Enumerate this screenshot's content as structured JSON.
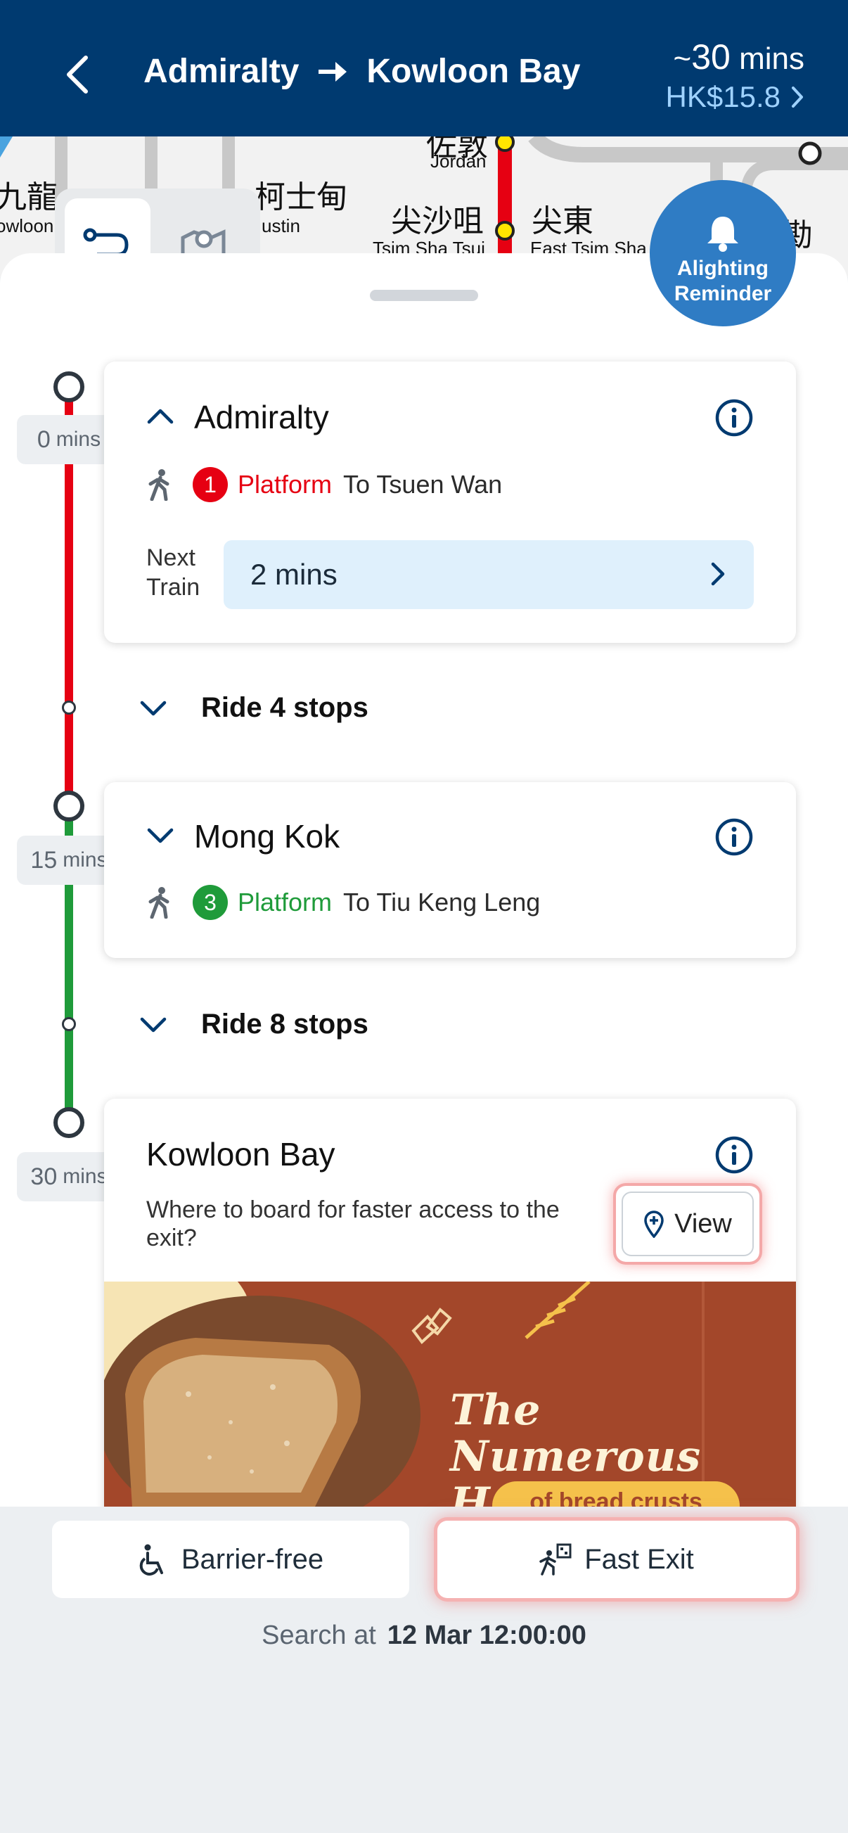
{
  "header": {
    "from": "Admiralty",
    "to": "Kowloon Bay",
    "duration_prefix": "~",
    "duration_value": "30",
    "duration_unit": "mins",
    "fare": "HK$15.8"
  },
  "map": {
    "labels": [
      {
        "cjk": "九龍",
        "en": "owloon"
      },
      {
        "cjk": "柯士甸",
        "en": "ustin"
      },
      {
        "cjk": "佐敦",
        "en": "Jordan"
      },
      {
        "cjk": "尖沙咀",
        "en": "Tsim Sha Tsui"
      },
      {
        "cjk": "尖東",
        "en": "East Tsim Sha"
      },
      {
        "cjk": "勘",
        "en": ""
      }
    ]
  },
  "alighting_reminder": {
    "label": "Alighting Reminder"
  },
  "stations": [
    {
      "name": "Admiralty",
      "time_value": "0",
      "time_unit": "mins",
      "platform_number": "1",
      "platform_label": "Platform",
      "direction": "To Tsuen Wan",
      "next_train_label": "Next Train",
      "next_train_value": "2 mins",
      "line_color": "#e60012"
    },
    {
      "name": "Mong Kok",
      "time_value": "15",
      "time_unit": "mins",
      "platform_number": "3",
      "platform_label": "Platform",
      "direction": "To Tiu Keng Leng",
      "line_color": "#1f9b3a"
    },
    {
      "name": "Kowloon Bay",
      "time_value": "30",
      "time_unit": "mins",
      "exit_question": "Where to board for faster access to the exit?",
      "view_label": "View"
    }
  ],
  "rides": [
    {
      "label": "Ride 4 stops"
    },
    {
      "label": "Ride 8 stops"
    }
  ],
  "ad": {
    "title": "The Numerous Health Benefits",
    "subtitle": "of bread crusts"
  },
  "bottom": {
    "barrier_free_label": "Barrier-free",
    "fast_exit_label": "Fast Exit",
    "search_label": "Search at",
    "search_time": "12 Mar 12:00:00"
  },
  "colors": {
    "header_bg": "#003a70",
    "fare": "#9fd2ff",
    "tsuen_wan_line": "#e60012",
    "kwun_tong_line": "#1f9b3a",
    "next_train_bg": "#dff0fc",
    "accent_blue": "#2f7cc4"
  }
}
